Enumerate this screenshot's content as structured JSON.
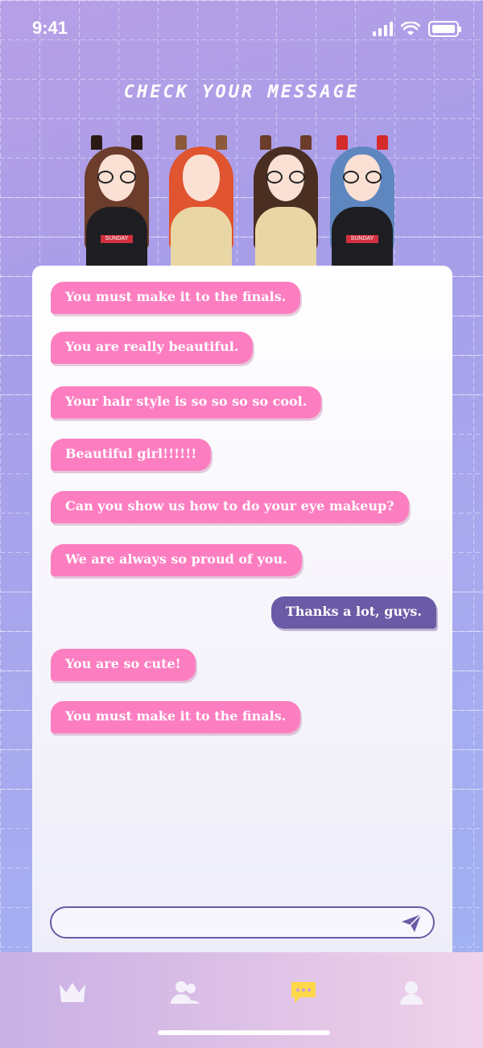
{
  "status_bar": {
    "time": "9:41"
  },
  "header": {
    "title": "CHECK YOUR MESSAGE"
  },
  "characters": [
    {
      "shirt": "SUNDAY",
      "hair": "#6b3d2a",
      "top": "#1e1e22",
      "ears": "#2b1a14"
    },
    {
      "shirt": "",
      "hair": "#e0542f",
      "top": "#e9d6a5",
      "ears": "#8a5a3a"
    },
    {
      "shirt": "",
      "hair": "#4a2e22",
      "top": "#e9d6a5",
      "ears": "#6b3d2a"
    },
    {
      "shirt": "SUNDAY",
      "hair": "#5e86bf",
      "top": "#1e1e22",
      "ears": "#d42a2a"
    }
  ],
  "messages": [
    {
      "text": "You must make it to the finals.",
      "side": "in"
    },
    {
      "text": "You are really beautiful.",
      "side": "in"
    },
    {
      "text": "Your hair style is so so so so cool.",
      "side": "in"
    },
    {
      "text": "Beautiful girl!!!!!!",
      "side": "in"
    },
    {
      "text": "Can you show us how to do your eye makeup?",
      "side": "in"
    },
    {
      "text": "We are always so proud of you.",
      "side": "in"
    },
    {
      "text": "Thanks a lot, guys.",
      "side": "out"
    },
    {
      "text": "You are so cute!",
      "side": "in"
    },
    {
      "text": "You must make it to the finals.",
      "side": "in"
    }
  ],
  "composer": {
    "value": "",
    "placeholder": ""
  },
  "tabs": [
    {
      "icon": "crown-icon",
      "active": false
    },
    {
      "icon": "friends-icon",
      "active": false
    },
    {
      "icon": "chat-icon",
      "active": true
    },
    {
      "icon": "profile-icon",
      "active": false
    }
  ],
  "colors": {
    "incoming_bubble": "#fd7ec0",
    "outgoing_bubble": "#6b5aa6",
    "active_tab": "#ffd84a",
    "inactive_tab": "#f4f1fb"
  }
}
